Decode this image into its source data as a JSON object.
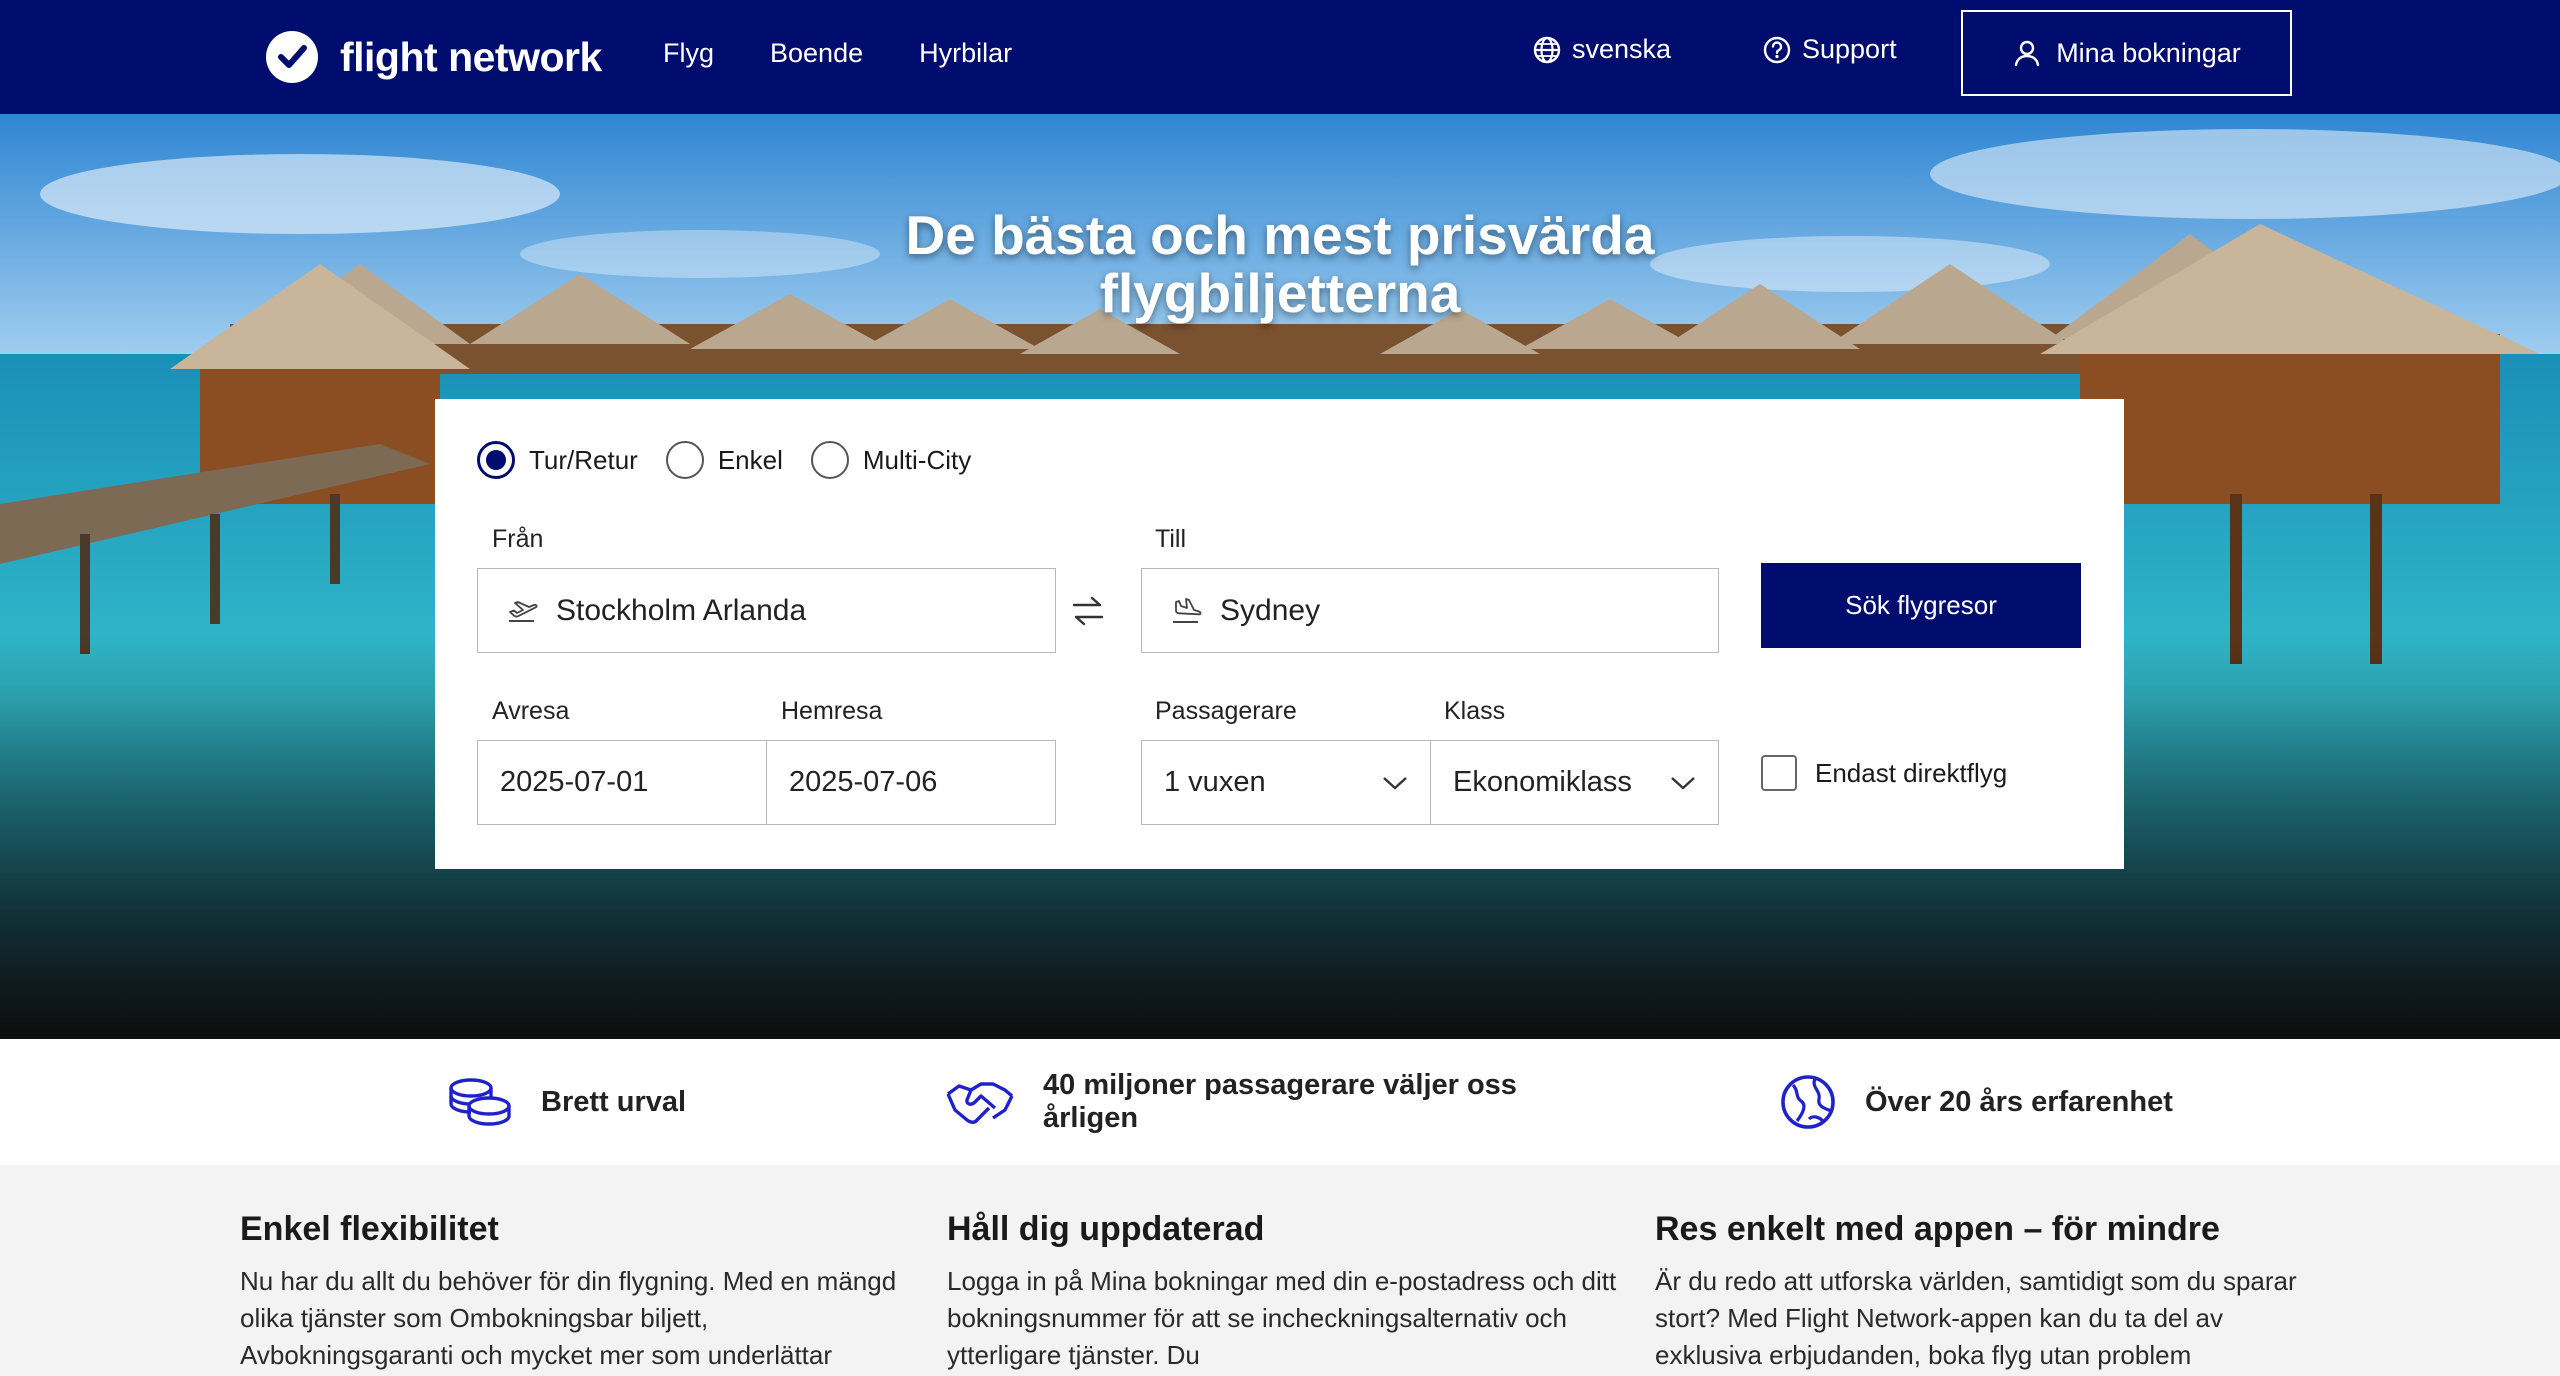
{
  "header": {
    "logo_text": "flight network",
    "nav": [
      "Flyg",
      "Boende",
      "Hyrbilar"
    ],
    "language": "svenska",
    "support": "Support",
    "bookings": "Mina bokningar"
  },
  "hero": {
    "title_line1": "De bästa och mest prisvärda",
    "title_line2": "flygbiljetterna"
  },
  "search": {
    "trip_types": [
      "Tur/Retur",
      "Enkel",
      "Multi-City"
    ],
    "selected_trip_type": "Tur/Retur",
    "from_label": "Från",
    "from_value": "Stockholm Arlanda",
    "to_label": "Till",
    "to_value": "Sydney",
    "search_button": "Sök flygresor",
    "depart_label": "Avresa",
    "depart_value": "2025-07-01",
    "return_label": "Hemresa",
    "return_value": "2025-07-06",
    "passengers_label": "Passagerare",
    "passengers_value": "1 vuxen",
    "class_label": "Klass",
    "class_value": "Ekonomiklass",
    "direct_only": "Endast direktflyg"
  },
  "features": [
    {
      "icon": "coins-icon",
      "text": "Brett urval"
    },
    {
      "icon": "handshake-icon",
      "text_line1": "40 miljoner passagerare väljer oss",
      "text_line2": "årligen"
    },
    {
      "icon": "globe-icon",
      "text": "Över 20 års erfarenhet"
    }
  ],
  "info": [
    {
      "title": "Enkel flexibilitet",
      "text": "Nu har du allt du behöver för din flygning. Med en mängd olika tjänster som Ombokningsbar biljett, Avbokningsgaranti och mycket mer som underlättar"
    },
    {
      "title": "Håll dig uppdaterad",
      "text": "Logga in på Mina bokningar med din e-postadress och ditt bokningsnummer för att se incheckningsalternativ och ytterligare tjänster. Du"
    },
    {
      "title": "Res enkelt med appen – för mindre",
      "text": "Är du redo att utforska världen, samtidigt som du sparar stort? Med Flight Network-appen kan du ta del av exklusiva erbjudanden, boka flyg utan problem"
    }
  ],
  "colors": {
    "brand": "#000d6e",
    "white": "#ffffff"
  }
}
